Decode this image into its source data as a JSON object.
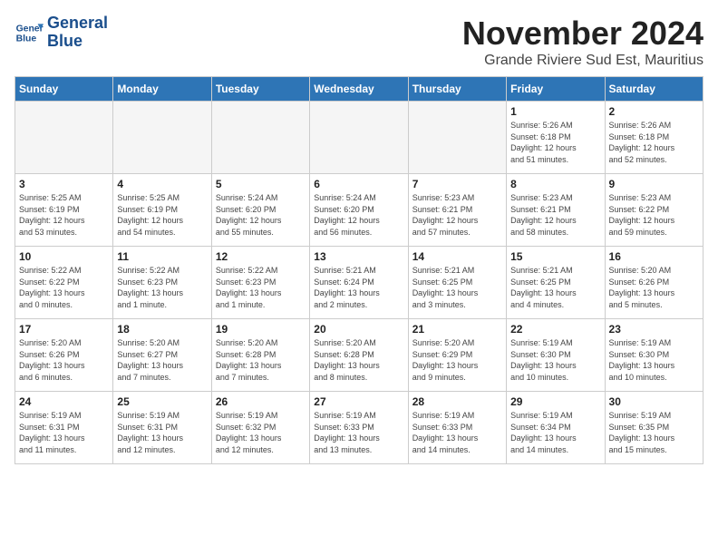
{
  "logo": {
    "line1": "General",
    "line2": "Blue"
  },
  "title": "November 2024",
  "location": "Grande Riviere Sud Est, Mauritius",
  "weekdays": [
    "Sunday",
    "Monday",
    "Tuesday",
    "Wednesday",
    "Thursday",
    "Friday",
    "Saturday"
  ],
  "weeks": [
    [
      {
        "day": "",
        "info": ""
      },
      {
        "day": "",
        "info": ""
      },
      {
        "day": "",
        "info": ""
      },
      {
        "day": "",
        "info": ""
      },
      {
        "day": "",
        "info": ""
      },
      {
        "day": "1",
        "info": "Sunrise: 5:26 AM\nSunset: 6:18 PM\nDaylight: 12 hours\nand 51 minutes."
      },
      {
        "day": "2",
        "info": "Sunrise: 5:26 AM\nSunset: 6:18 PM\nDaylight: 12 hours\nand 52 minutes."
      }
    ],
    [
      {
        "day": "3",
        "info": "Sunrise: 5:25 AM\nSunset: 6:19 PM\nDaylight: 12 hours\nand 53 minutes."
      },
      {
        "day": "4",
        "info": "Sunrise: 5:25 AM\nSunset: 6:19 PM\nDaylight: 12 hours\nand 54 minutes."
      },
      {
        "day": "5",
        "info": "Sunrise: 5:24 AM\nSunset: 6:20 PM\nDaylight: 12 hours\nand 55 minutes."
      },
      {
        "day": "6",
        "info": "Sunrise: 5:24 AM\nSunset: 6:20 PM\nDaylight: 12 hours\nand 56 minutes."
      },
      {
        "day": "7",
        "info": "Sunrise: 5:23 AM\nSunset: 6:21 PM\nDaylight: 12 hours\nand 57 minutes."
      },
      {
        "day": "8",
        "info": "Sunrise: 5:23 AM\nSunset: 6:21 PM\nDaylight: 12 hours\nand 58 minutes."
      },
      {
        "day": "9",
        "info": "Sunrise: 5:23 AM\nSunset: 6:22 PM\nDaylight: 12 hours\nand 59 minutes."
      }
    ],
    [
      {
        "day": "10",
        "info": "Sunrise: 5:22 AM\nSunset: 6:22 PM\nDaylight: 13 hours\nand 0 minutes."
      },
      {
        "day": "11",
        "info": "Sunrise: 5:22 AM\nSunset: 6:23 PM\nDaylight: 13 hours\nand 1 minute."
      },
      {
        "day": "12",
        "info": "Sunrise: 5:22 AM\nSunset: 6:23 PM\nDaylight: 13 hours\nand 1 minute."
      },
      {
        "day": "13",
        "info": "Sunrise: 5:21 AM\nSunset: 6:24 PM\nDaylight: 13 hours\nand 2 minutes."
      },
      {
        "day": "14",
        "info": "Sunrise: 5:21 AM\nSunset: 6:25 PM\nDaylight: 13 hours\nand 3 minutes."
      },
      {
        "day": "15",
        "info": "Sunrise: 5:21 AM\nSunset: 6:25 PM\nDaylight: 13 hours\nand 4 minutes."
      },
      {
        "day": "16",
        "info": "Sunrise: 5:20 AM\nSunset: 6:26 PM\nDaylight: 13 hours\nand 5 minutes."
      }
    ],
    [
      {
        "day": "17",
        "info": "Sunrise: 5:20 AM\nSunset: 6:26 PM\nDaylight: 13 hours\nand 6 minutes."
      },
      {
        "day": "18",
        "info": "Sunrise: 5:20 AM\nSunset: 6:27 PM\nDaylight: 13 hours\nand 7 minutes."
      },
      {
        "day": "19",
        "info": "Sunrise: 5:20 AM\nSunset: 6:28 PM\nDaylight: 13 hours\nand 7 minutes."
      },
      {
        "day": "20",
        "info": "Sunrise: 5:20 AM\nSunset: 6:28 PM\nDaylight: 13 hours\nand 8 minutes."
      },
      {
        "day": "21",
        "info": "Sunrise: 5:20 AM\nSunset: 6:29 PM\nDaylight: 13 hours\nand 9 minutes."
      },
      {
        "day": "22",
        "info": "Sunrise: 5:19 AM\nSunset: 6:30 PM\nDaylight: 13 hours\nand 10 minutes."
      },
      {
        "day": "23",
        "info": "Sunrise: 5:19 AM\nSunset: 6:30 PM\nDaylight: 13 hours\nand 10 minutes."
      }
    ],
    [
      {
        "day": "24",
        "info": "Sunrise: 5:19 AM\nSunset: 6:31 PM\nDaylight: 13 hours\nand 11 minutes."
      },
      {
        "day": "25",
        "info": "Sunrise: 5:19 AM\nSunset: 6:31 PM\nDaylight: 13 hours\nand 12 minutes."
      },
      {
        "day": "26",
        "info": "Sunrise: 5:19 AM\nSunset: 6:32 PM\nDaylight: 13 hours\nand 12 minutes."
      },
      {
        "day": "27",
        "info": "Sunrise: 5:19 AM\nSunset: 6:33 PM\nDaylight: 13 hours\nand 13 minutes."
      },
      {
        "day": "28",
        "info": "Sunrise: 5:19 AM\nSunset: 6:33 PM\nDaylight: 13 hours\nand 14 minutes."
      },
      {
        "day": "29",
        "info": "Sunrise: 5:19 AM\nSunset: 6:34 PM\nDaylight: 13 hours\nand 14 minutes."
      },
      {
        "day": "30",
        "info": "Sunrise: 5:19 AM\nSunset: 6:35 PM\nDaylight: 13 hours\nand 15 minutes."
      }
    ]
  ]
}
